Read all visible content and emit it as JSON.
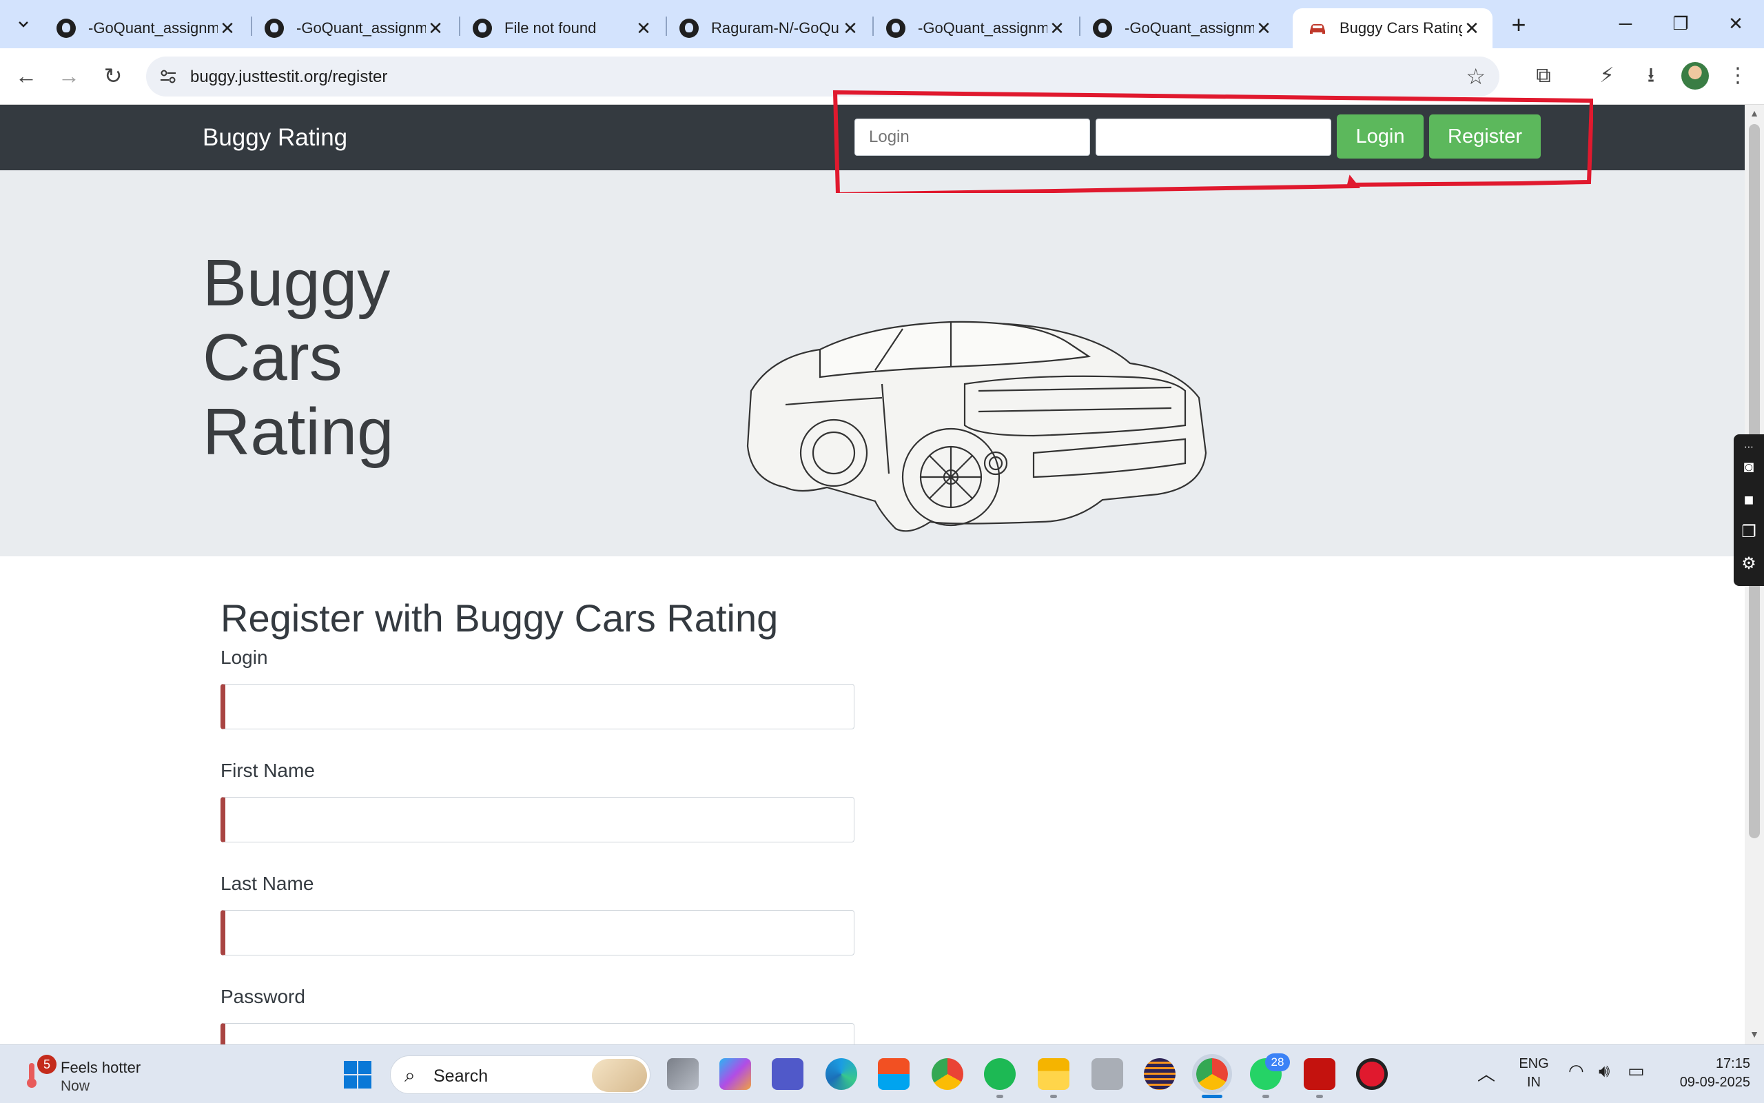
{
  "browser": {
    "tabs": [
      {
        "title": "-GoQuant_assignm"
      },
      {
        "title": "-GoQuant_assignm"
      },
      {
        "title": "File not found"
      },
      {
        "title": "Raguram-N/-GoQu"
      },
      {
        "title": "-GoQuant_assignm"
      },
      {
        "title": "-GoQuant_assignm"
      },
      {
        "title": "Buggy Cars Rating"
      }
    ],
    "close_glyph": "✕",
    "new_tab_glyph": "+",
    "url": "buggy.justtestit.org/register",
    "win": {
      "minimize": "─",
      "restore": "❐",
      "close": "✕"
    },
    "nav": {
      "back": "←",
      "forward": "→",
      "reload": "↻",
      "star": "☆"
    },
    "toolbar_icons": {
      "extensions": "⧉",
      "performance": "⚡",
      "download": "⭳",
      "menu": "⋮"
    }
  },
  "page": {
    "brand": "Buggy Rating",
    "nav_login_placeholder": "Login",
    "nav_password_value": "",
    "login_button": "Login",
    "register_button": "Register",
    "jumbo_line1": "Buggy",
    "jumbo_line2": "Cars",
    "jumbo_line3": "Rating",
    "form_heading": "Register with Buggy Cars Rating",
    "fields": [
      {
        "label": "Login"
      },
      {
        "label": "First Name"
      },
      {
        "label": "Last Name"
      },
      {
        "label": "Password"
      }
    ],
    "annotation_color": "#e0192e"
  },
  "taskbar": {
    "weather_title": "Feels hotter",
    "weather_time": "Now",
    "weather_badge": "5",
    "search_label": "Search",
    "whatsapp_badge": "28",
    "tray_chevron": "︿",
    "lang_line1": "ENG",
    "lang_line2": "IN",
    "time": "17:15",
    "date": "09-09-2025"
  }
}
